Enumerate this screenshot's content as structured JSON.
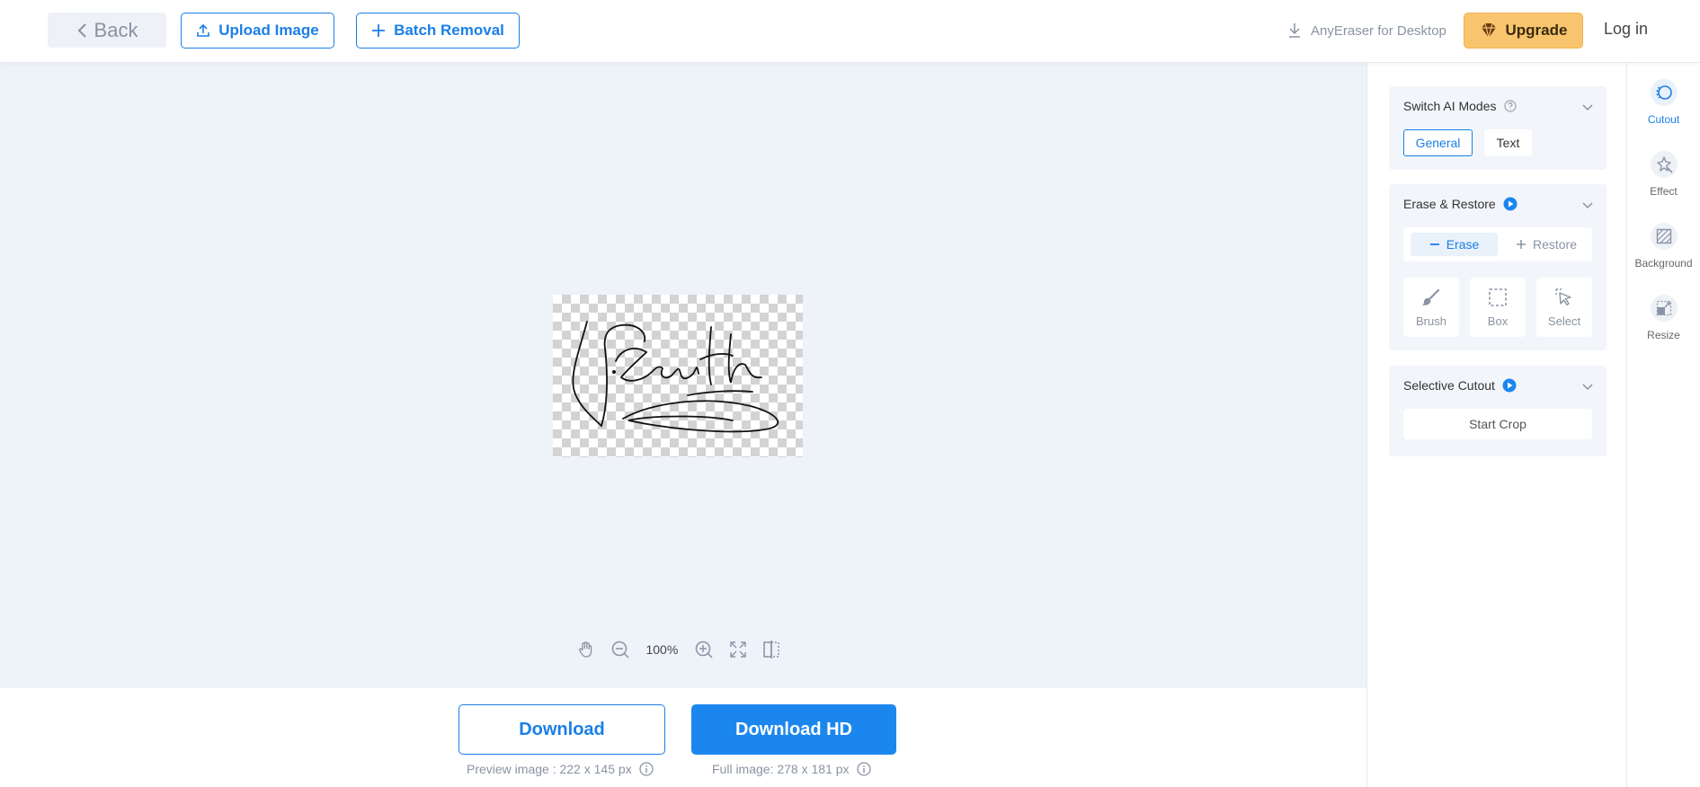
{
  "header": {
    "back_label": "Back",
    "upload_label": "Upload Image",
    "batch_label": "Batch Removal",
    "desktop_label": "AnyEraser for Desktop",
    "upgrade_label": "Upgrade",
    "login_label": "Log in"
  },
  "canvas": {
    "zoom_level": "100%"
  },
  "download": {
    "download_label": "Download",
    "download_hd_label": "Download HD",
    "preview_note": "Preview image : 222 x 145 px",
    "full_note": "Full image: 278 x 181 px"
  },
  "panel": {
    "ai_modes": {
      "title": "Switch AI Modes",
      "general_label": "General",
      "text_label": "Text"
    },
    "erase_restore": {
      "title": "Erase & Restore",
      "erase_label": "Erase",
      "restore_label": "Restore",
      "tools": [
        {
          "label": "Brush",
          "icon": "brush-icon"
        },
        {
          "label": "Box",
          "icon": "box-select-icon"
        },
        {
          "label": "Select",
          "icon": "cursor-select-icon"
        }
      ]
    },
    "selective_cutout": {
      "title": "Selective Cutout",
      "start_crop_label": "Start Crop"
    }
  },
  "sidenav": {
    "items": [
      {
        "label": "Cutout",
        "icon": "cutout-icon",
        "active": true
      },
      {
        "label": "Effect",
        "icon": "effect-icon",
        "active": false
      },
      {
        "label": "Background",
        "icon": "background-icon",
        "active": false
      },
      {
        "label": "Resize",
        "icon": "resize-icon",
        "active": false
      }
    ]
  },
  "colors": {
    "accent": "#1b87ee",
    "upgrade": "#f8c56e",
    "canvas_bg": "#eef2f9"
  }
}
